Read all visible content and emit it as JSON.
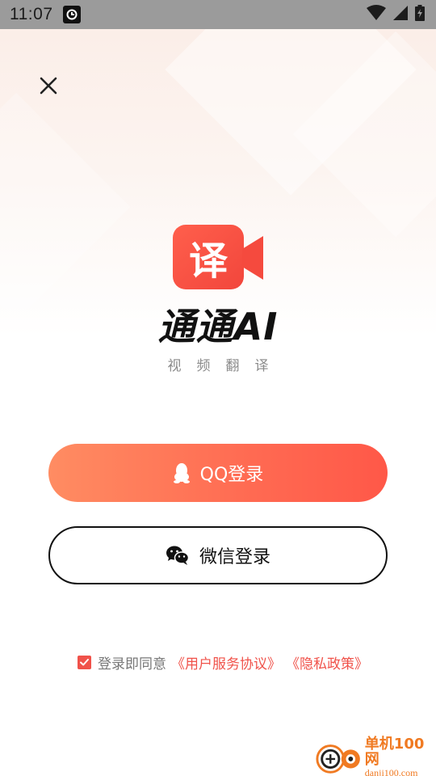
{
  "status_bar": {
    "time": "11:07",
    "icons": [
      "app-notification-icon",
      "wifi-icon",
      "signal-icon",
      "battery-charging-icon"
    ]
  },
  "close": {
    "icon": "close-icon"
  },
  "logo": {
    "badge_text": "译",
    "title": "通通AI",
    "subtitle": "视频翻译",
    "icon": "video-camera-icon"
  },
  "buttons": {
    "qq_label": "QQ登录",
    "qq_icon": "qq-penguin-icon",
    "wechat_label": "微信登录",
    "wechat_icon": "wechat-icon"
  },
  "agreement": {
    "checked": true,
    "prefix": "登录即同意",
    "terms_link": "《用户服务协议》",
    "privacy_link": "《隐私政策》"
  },
  "watermark": {
    "cn": "单机100网",
    "en": "danji100.com"
  },
  "colors": {
    "accent": "#f0524a",
    "qq_gradient_start": "#ff8c62",
    "qq_gradient_end": "#ff5848",
    "status_bar": "#9b9b9b"
  }
}
